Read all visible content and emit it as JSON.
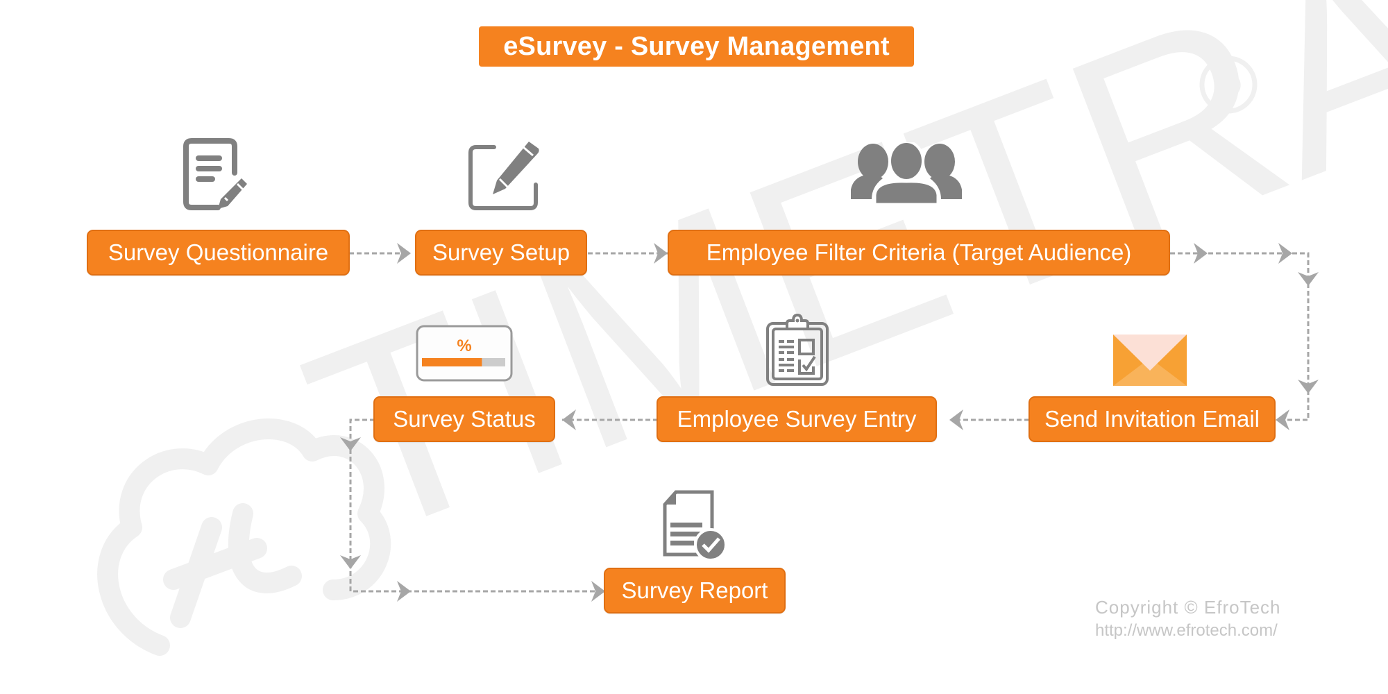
{
  "title": "eSurvey - Survey Management",
  "colors": {
    "accent": "#f5821f",
    "accent_border": "#e06f12",
    "icon_gray": "#808080",
    "connector_gray": "#a6a6a6",
    "watermark_gray": "#f0f0f0",
    "envelope_orange": "#f7a134",
    "envelope_light": "#fce0d6"
  },
  "nodes": [
    {
      "id": "survey-questionnaire",
      "label": "Survey Questionnaire",
      "icon": "document-edit-icon"
    },
    {
      "id": "survey-setup",
      "label": "Survey Setup",
      "icon": "edit-square-icon"
    },
    {
      "id": "employee-filter-criteria",
      "label": "Employee Filter Criteria (Target Audience)",
      "icon": "users-group-icon"
    },
    {
      "id": "send-invitation-email",
      "label": "Send Invitation Email",
      "icon": "envelope-icon"
    },
    {
      "id": "employee-survey-entry",
      "label": "Employee Survey Entry",
      "icon": "clipboard-checklist-icon"
    },
    {
      "id": "survey-status",
      "label": "Survey Status",
      "icon": "progress-percent-icon"
    },
    {
      "id": "survey-report",
      "label": "Survey Report",
      "icon": "report-check-icon"
    }
  ],
  "flow": [
    {
      "from": "survey-questionnaire",
      "to": "survey-setup"
    },
    {
      "from": "survey-setup",
      "to": "employee-filter-criteria"
    },
    {
      "from": "employee-filter-criteria",
      "to": "send-invitation-email"
    },
    {
      "from": "send-invitation-email",
      "to": "employee-survey-entry"
    },
    {
      "from": "employee-survey-entry",
      "to": "survey-status"
    },
    {
      "from": "survey-status",
      "to": "survey-report"
    }
  ],
  "status_icon": {
    "symbol": "%",
    "progress_fraction": 0.72
  },
  "watermark": {
    "text": "TIMETRAX",
    "mark": "®"
  },
  "copyright": {
    "line1": "Copyright © EfroTech",
    "line2": "http://www.efrotech.com/"
  }
}
